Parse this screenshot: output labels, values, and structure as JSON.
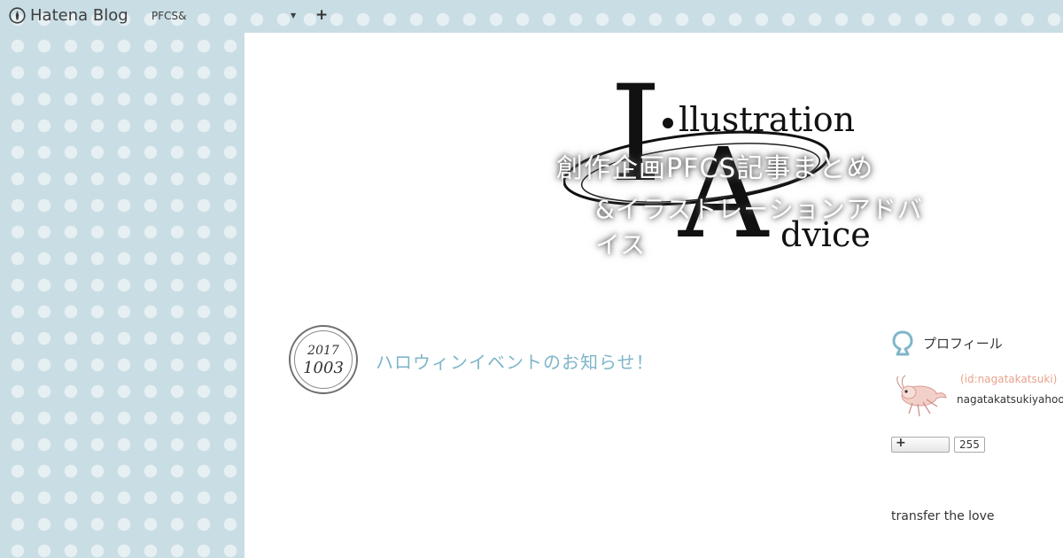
{
  "topbar": {
    "logo_text": "Hatena Blog",
    "blog_select_value": "PFCS&",
    "plus_label": "+"
  },
  "header": {
    "logo_letter_1": "I",
    "logo_word_1": "llustration",
    "logo_letter_2": "A",
    "logo_word_2": "dvice",
    "overlay_line_1": "創作企画PFCS記事まとめ",
    "overlay_line_2": "&イラストレーションアドバイス"
  },
  "entry": {
    "date_year": "2017",
    "date_monthday": "1003",
    "title": "ハロウィンイベントのお知らせ！"
  },
  "sidebar": {
    "profile_heading": "プロフィール",
    "profile_id": "(id:nagatakatsuki)",
    "profile_email": "nagatakatsukiyahoo",
    "follow_count": "255",
    "section_title": "transfer the love"
  },
  "colors": {
    "background": "#c9dde4",
    "entry_title": "#7fb6c9",
    "profile_id": "#e8a38c"
  },
  "icons": {
    "hatena": "hatena-pen-icon",
    "profile": "profile-balloon-icon",
    "plus": "plus-icon"
  }
}
